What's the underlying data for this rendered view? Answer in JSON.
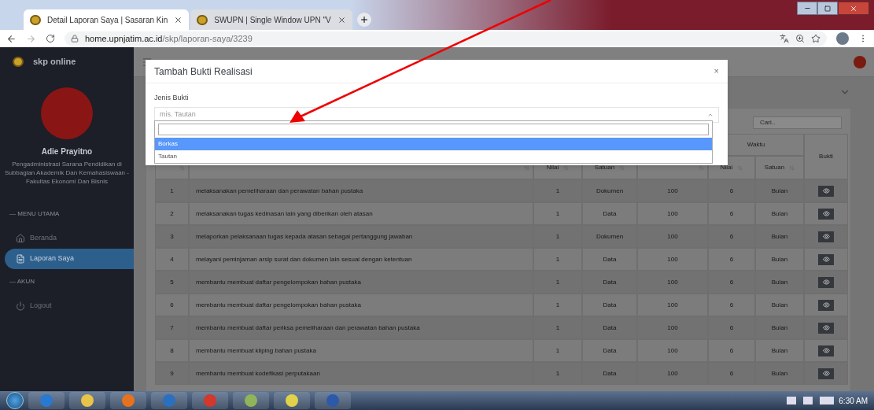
{
  "browser": {
    "tabs": [
      {
        "title": "Detail Laporan Saya | Sasaran Kin",
        "selected": true
      },
      {
        "title": "SWUPN | Single Window UPN \"V",
        "selected": false
      }
    ],
    "url_host": "home.upnjatim.ac.id",
    "url_path": "/skp/laporan-saya/3239"
  },
  "sidebar": {
    "brand": "skp online",
    "user_name": "Adie Prayitno",
    "user_role": "Pengadministrasi Sarana Pendidikan di Subbagian Akademik Dan Kemahasiswaan - Fakultas Ekonomi Dan Bisnis",
    "sections": [
      {
        "heading": "— MENU UTAMA",
        "items": [
          {
            "label": "Beranda",
            "kind": "home",
            "selected": false
          },
          {
            "label": "Laporan Saya",
            "kind": "file",
            "selected": true
          }
        ]
      },
      {
        "heading": "— AKUN",
        "items": [
          {
            "label": "Logout",
            "kind": "power",
            "selected": false
          }
        ]
      }
    ]
  },
  "table": {
    "search_placeholder": "Cari..",
    "group_header": "Waktu",
    "bukti_header": "Bukti",
    "sub_headers": [
      "Nilai",
      "Satuan",
      "Nilai",
      "Satuan"
    ],
    "rows": [
      {
        "no": "1",
        "kegiatan": "melaksanakan pemeliharaan dan perawatan bahan pustaka",
        "nilai": "1",
        "satuan": "Dokumen",
        "column_5": "100",
        "waktu_nilai": "6",
        "waktu_satuan": "Bulan"
      },
      {
        "no": "2",
        "kegiatan": "melaksanakan tugas kedinasan lain yang diberikan oleh atasan",
        "nilai": "1",
        "satuan": "Data",
        "column_5": "100",
        "waktu_nilai": "6",
        "waktu_satuan": "Bulan"
      },
      {
        "no": "3",
        "kegiatan": "melaporkan pelaksanaan tugas kepada atasan sebagai pertanggung jawaban",
        "nilai": "1",
        "satuan": "Dokumen",
        "column_5": "100",
        "waktu_nilai": "6",
        "waktu_satuan": "Bulan"
      },
      {
        "no": "4",
        "kegiatan": "melayani peminjaman arsip surat dan dokumen lain sesuai dengan ketentuan",
        "nilai": "1",
        "satuan": "Data",
        "column_5": "100",
        "waktu_nilai": "6",
        "waktu_satuan": "Bulan"
      },
      {
        "no": "5",
        "kegiatan": "membantu membuat daftar pengelompokan bahan pustaka",
        "nilai": "1",
        "satuan": "Data",
        "column_5": "100",
        "waktu_nilai": "6",
        "waktu_satuan": "Bulan"
      },
      {
        "no": "6",
        "kegiatan": "membantu membuat daftar pengelompokan bahan pustaka",
        "nilai": "1",
        "satuan": "Data",
        "column_5": "100",
        "waktu_nilai": "6",
        "waktu_satuan": "Bulan"
      },
      {
        "no": "7",
        "kegiatan": "membantu membuat daftar periksa pemeliharaan dan perawatan bahan pustaka",
        "nilai": "1",
        "satuan": "Data",
        "column_5": "100",
        "waktu_nilai": "6",
        "waktu_satuan": "Bulan"
      },
      {
        "no": "8",
        "kegiatan": "membantu membuat kliping bahan pustaka",
        "nilai": "1",
        "satuan": "Data",
        "column_5": "100",
        "waktu_nilai": "6",
        "waktu_satuan": "Bulan"
      },
      {
        "no": "9",
        "kegiatan": "membantu membuat kodefikasi perputakaan",
        "nilai": "1",
        "satuan": "Data",
        "column_5": "100",
        "waktu_nilai": "6",
        "waktu_satuan": "Bulan"
      }
    ]
  },
  "modal": {
    "title": "Tambah Bukti Realisasi",
    "close": "×",
    "field_label": "Jenis Bukti",
    "placeholder": "mis. Tautan",
    "options": [
      {
        "label": "Borkas",
        "selected": true
      },
      {
        "label": "Tautan",
        "selected": false
      }
    ]
  },
  "taskbar": {
    "time": "6:30 AM"
  }
}
